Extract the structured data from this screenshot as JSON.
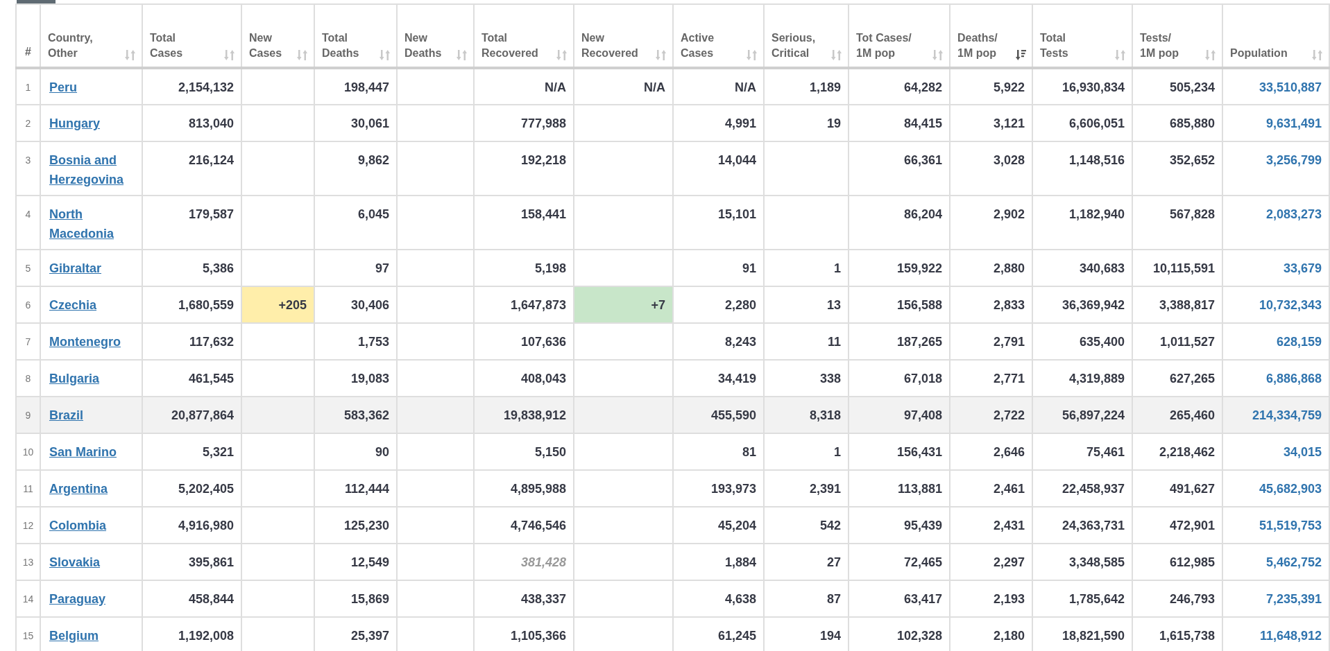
{
  "table": {
    "columns": [
      {
        "label": "#"
      },
      {
        "label": "Country,\nOther",
        "sortable": true,
        "sort_active": false
      },
      {
        "label": "Total\nCases",
        "sortable": true,
        "sort_active": false
      },
      {
        "label": "New\nCases",
        "sortable": true,
        "sort_active": false
      },
      {
        "label": "Total\nDeaths",
        "sortable": true,
        "sort_active": false
      },
      {
        "label": "New\nDeaths",
        "sortable": true,
        "sort_active": false
      },
      {
        "label": "Total\nRecovered",
        "sortable": true,
        "sort_active": false
      },
      {
        "label": "New\nRecovered",
        "sortable": true,
        "sort_active": false
      },
      {
        "label": "Active\nCases",
        "sortable": true,
        "sort_active": false
      },
      {
        "label": "Serious,\nCritical",
        "sortable": true,
        "sort_active": false
      },
      {
        "label": "Tot Cases/\n1M pop",
        "sortable": true,
        "sort_active": false
      },
      {
        "label": "Deaths/\n1M pop",
        "sortable": true,
        "sort_active": true
      },
      {
        "label": "Total\nTests",
        "sortable": true,
        "sort_active": false
      },
      {
        "label": "Tests/\n1M pop",
        "sortable": true,
        "sort_active": false
      },
      {
        "label": "Population",
        "sortable": true,
        "sort_active": false
      }
    ],
    "rows": [
      {
        "num": "1",
        "country": "Peru",
        "total_cases": "2,154,132",
        "total_deaths": "198,447",
        "total_recovered": "N/A",
        "new_recovered": "N/A",
        "active_cases": "N/A",
        "serious_critical": "1,189",
        "tot_cases_per_1m": "64,282",
        "deaths_per_1m": "5,922",
        "total_tests": "16,930,834",
        "tests_per_1m": "505,234",
        "population": "33,510,887",
        "highlighted": false,
        "recovered_estimated": false
      },
      {
        "num": "2",
        "country": "Hungary",
        "total_cases": "813,040",
        "total_deaths": "30,061",
        "total_recovered": "777,988",
        "active_cases": "4,991",
        "serious_critical": "19",
        "tot_cases_per_1m": "84,415",
        "deaths_per_1m": "3,121",
        "total_tests": "6,606,051",
        "tests_per_1m": "685,880",
        "population": "9,631,491",
        "highlighted": false,
        "recovered_estimated": false
      },
      {
        "num": "3",
        "country": "Bosnia and Herzegovina",
        "total_cases": "216,124",
        "total_deaths": "9,862",
        "total_recovered": "192,218",
        "active_cases": "14,044",
        "tot_cases_per_1m": "66,361",
        "deaths_per_1m": "3,028",
        "total_tests": "1,148,516",
        "tests_per_1m": "352,652",
        "population": "3,256,799",
        "highlighted": false,
        "recovered_estimated": false
      },
      {
        "num": "4",
        "country": "North Macedonia",
        "total_cases": "179,587",
        "total_deaths": "6,045",
        "total_recovered": "158,441",
        "active_cases": "15,101",
        "tot_cases_per_1m": "86,204",
        "deaths_per_1m": "2,902",
        "total_tests": "1,182,940",
        "tests_per_1m": "567,828",
        "population": "2,083,273",
        "highlighted": false,
        "recovered_estimated": false
      },
      {
        "num": "5",
        "country": "Gibraltar",
        "total_cases": "5,386",
        "total_deaths": "97",
        "total_recovered": "5,198",
        "active_cases": "91",
        "serious_critical": "1",
        "tot_cases_per_1m": "159,922",
        "deaths_per_1m": "2,880",
        "total_tests": "340,683",
        "tests_per_1m": "10,115,591",
        "population": "33,679",
        "highlighted": false,
        "recovered_estimated": false
      },
      {
        "num": "6",
        "country": "Czechia",
        "total_cases": "1,680,559",
        "new_cases": "+205",
        "total_deaths": "30,406",
        "total_recovered": "1,647,873",
        "new_recovered": "+7",
        "active_cases": "2,280",
        "serious_critical": "13",
        "tot_cases_per_1m": "156,588",
        "deaths_per_1m": "2,833",
        "total_tests": "36,369,942",
        "tests_per_1m": "3,388,817",
        "population": "10,732,343",
        "highlighted": false,
        "recovered_estimated": false
      },
      {
        "num": "7",
        "country": "Montenegro",
        "total_cases": "117,632",
        "total_deaths": "1,753",
        "total_recovered": "107,636",
        "active_cases": "8,243",
        "serious_critical": "11",
        "tot_cases_per_1m": "187,265",
        "deaths_per_1m": "2,791",
        "total_tests": "635,400",
        "tests_per_1m": "1,011,527",
        "population": "628,159",
        "highlighted": false,
        "recovered_estimated": false
      },
      {
        "num": "8",
        "country": "Bulgaria",
        "total_cases": "461,545",
        "total_deaths": "19,083",
        "total_recovered": "408,043",
        "active_cases": "34,419",
        "serious_critical": "338",
        "tot_cases_per_1m": "67,018",
        "deaths_per_1m": "2,771",
        "total_tests": "4,319,889",
        "tests_per_1m": "627,265",
        "population": "6,886,868",
        "highlighted": false,
        "recovered_estimated": false
      },
      {
        "num": "9",
        "country": "Brazil",
        "total_cases": "20,877,864",
        "total_deaths": "583,362",
        "total_recovered": "19,838,912",
        "active_cases": "455,590",
        "serious_critical": "8,318",
        "tot_cases_per_1m": "97,408",
        "deaths_per_1m": "2,722",
        "total_tests": "56,897,224",
        "tests_per_1m": "265,460",
        "population": "214,334,759",
        "highlighted": true,
        "recovered_estimated": false
      },
      {
        "num": "10",
        "country": "San Marino",
        "total_cases": "5,321",
        "total_deaths": "90",
        "total_recovered": "5,150",
        "active_cases": "81",
        "serious_critical": "1",
        "tot_cases_per_1m": "156,431",
        "deaths_per_1m": "2,646",
        "total_tests": "75,461",
        "tests_per_1m": "2,218,462",
        "population": "34,015",
        "highlighted": false,
        "recovered_estimated": false
      },
      {
        "num": "11",
        "country": "Argentina",
        "total_cases": "5,202,405",
        "total_deaths": "112,444",
        "total_recovered": "4,895,988",
        "active_cases": "193,973",
        "serious_critical": "2,391",
        "tot_cases_per_1m": "113,881",
        "deaths_per_1m": "2,461",
        "total_tests": "22,458,937",
        "tests_per_1m": "491,627",
        "population": "45,682,903",
        "highlighted": false,
        "recovered_estimated": false
      },
      {
        "num": "12",
        "country": "Colombia",
        "total_cases": "4,916,980",
        "total_deaths": "125,230",
        "total_recovered": "4,746,546",
        "active_cases": "45,204",
        "serious_critical": "542",
        "tot_cases_per_1m": "95,439",
        "deaths_per_1m": "2,431",
        "total_tests": "24,363,731",
        "tests_per_1m": "472,901",
        "population": "51,519,753",
        "highlighted": false,
        "recovered_estimated": false
      },
      {
        "num": "13",
        "country": "Slovakia",
        "total_cases": "395,861",
        "total_deaths": "12,549",
        "total_recovered": "381,428",
        "active_cases": "1,884",
        "serious_critical": "27",
        "tot_cases_per_1m": "72,465",
        "deaths_per_1m": "2,297",
        "total_tests": "3,348,585",
        "tests_per_1m": "612,985",
        "population": "5,462,752",
        "highlighted": false,
        "recovered_estimated": true
      },
      {
        "num": "14",
        "country": "Paraguay",
        "total_cases": "458,844",
        "total_deaths": "15,869",
        "total_recovered": "438,337",
        "active_cases": "4,638",
        "serious_critical": "87",
        "tot_cases_per_1m": "63,417",
        "deaths_per_1m": "2,193",
        "total_tests": "1,785,642",
        "tests_per_1m": "246,793",
        "population": "7,235,391",
        "highlighted": false,
        "recovered_estimated": false
      },
      {
        "num": "15",
        "country": "Belgium",
        "total_cases": "1,192,008",
        "total_deaths": "25,397",
        "total_recovered": "1,105,366",
        "active_cases": "61,245",
        "serious_critical": "194",
        "tot_cases_per_1m": "102,328",
        "deaths_per_1m": "2,180",
        "total_tests": "18,821,590",
        "tests_per_1m": "1,615,738",
        "population": "11,648,912",
        "highlighted": false,
        "recovered_estimated": false
      }
    ]
  }
}
